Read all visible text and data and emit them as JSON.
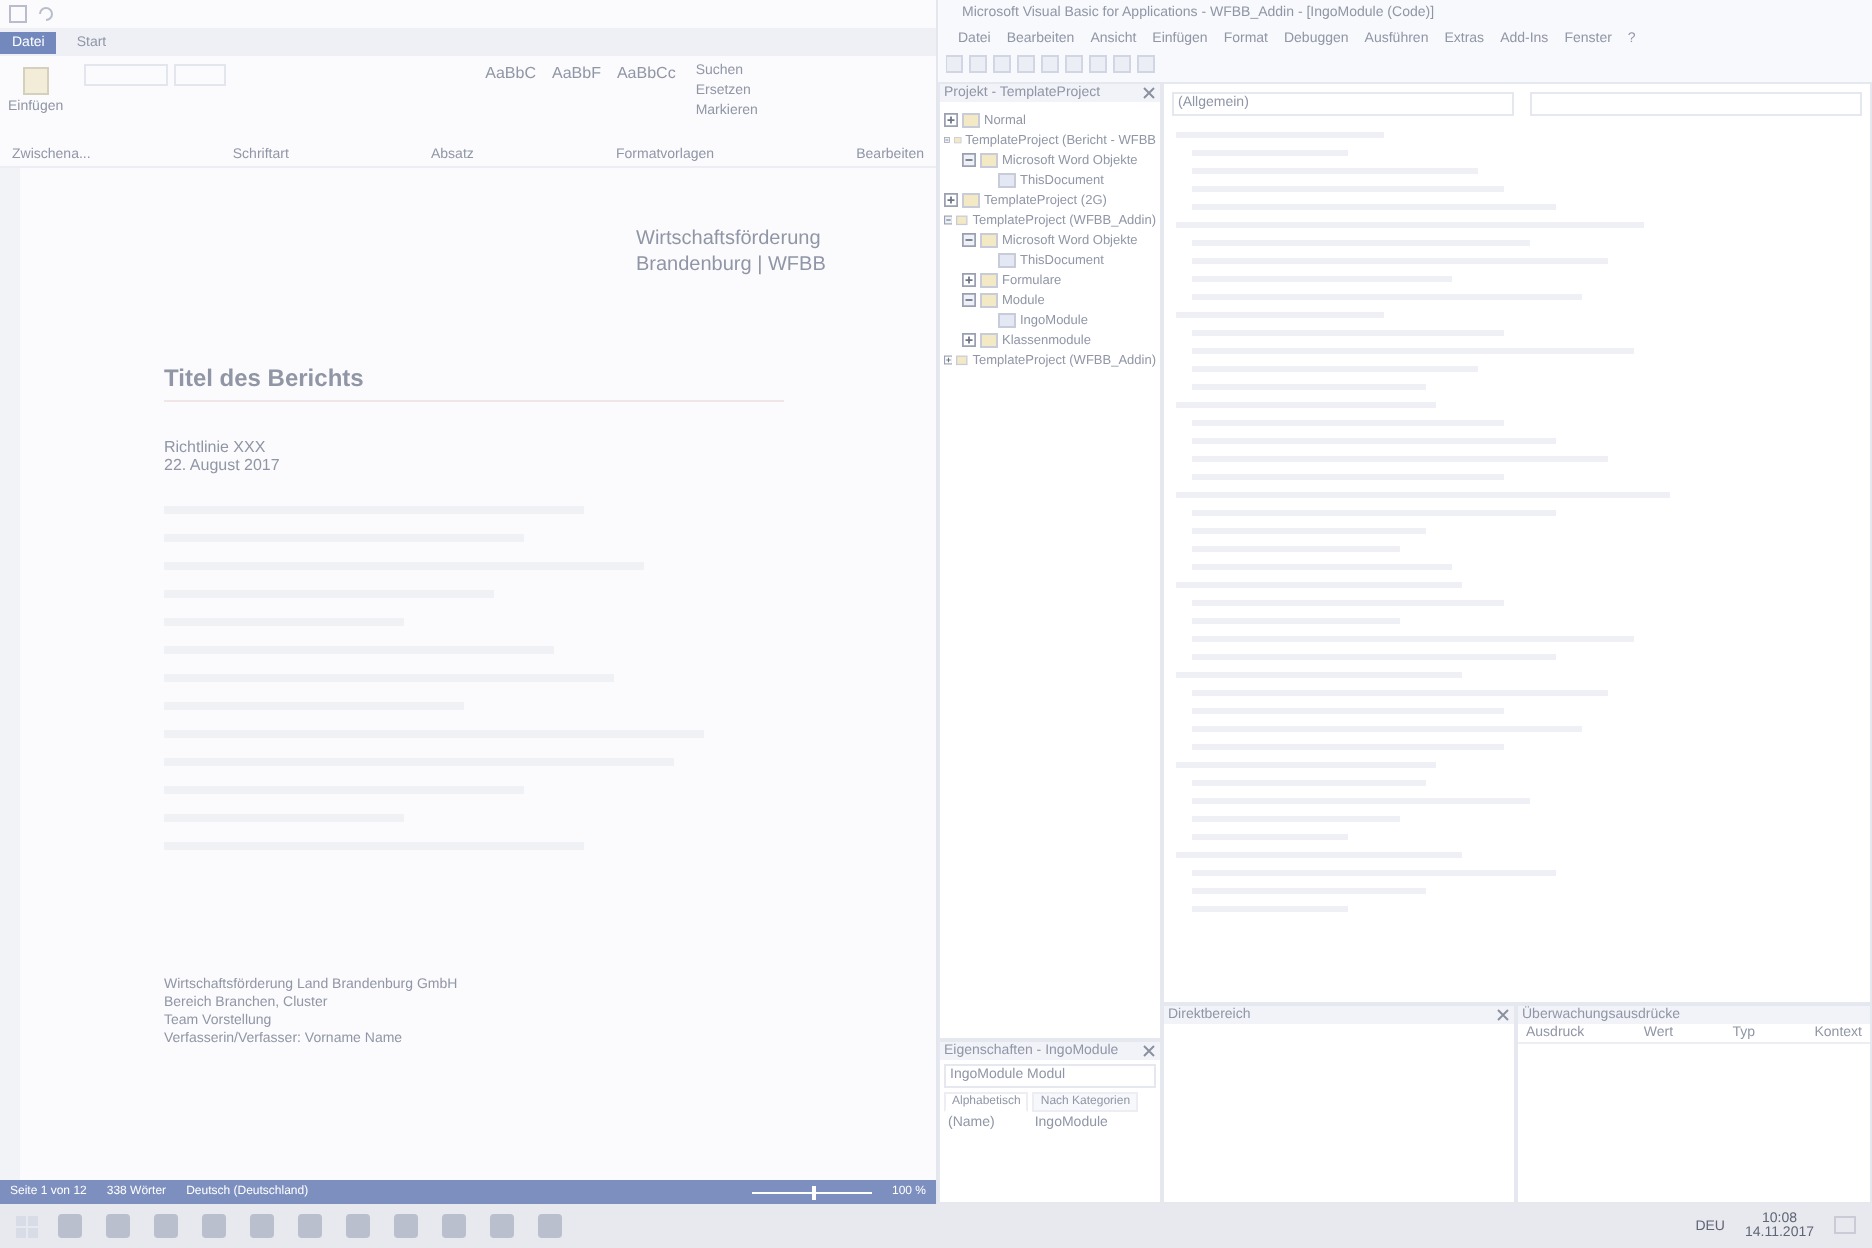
{
  "word": {
    "tabs": [
      {
        "label": "Datei",
        "selected": true
      },
      {
        "label": "Start",
        "selected": false
      }
    ],
    "paste_label": "Einfügen",
    "styles": [
      "AaBbC",
      "AaBbF",
      "AaBbCc"
    ],
    "edit_actions": [
      "Suchen",
      "Ersetzen",
      "Markieren"
    ],
    "groups": [
      "Zwischena...",
      "Schriftart",
      "Absatz",
      "Formatvorlagen",
      "Bearbeiten"
    ],
    "document": {
      "org_lines": [
        "Wirtschaftsförderung",
        "Brandenburg | WFBB"
      ],
      "title": "Titel des Berichts",
      "meta": [
        "Richtlinie XXX",
        "22. August 2017"
      ],
      "footer": [
        "Wirtschaftsförderung Land Brandenburg GmbH",
        "Bereich Branchen, Cluster",
        "Team Vorstellung",
        "Verfasserin/Verfasser: Vorname Name"
      ]
    },
    "status_bar": {
      "page": "Seite 1 von 12",
      "words": "338 Wörter",
      "language": "Deutsch (Deutschland)",
      "zoom": "100 %",
      "zoom_slider": {
        "level": 0.5
      }
    }
  },
  "vba": {
    "title": "Microsoft Visual Basic for Applications - WFBB_Addin - [IngoModule (Code)]",
    "menu": [
      "Datei",
      "Bearbeiten",
      "Ansicht",
      "Einfügen",
      "Format",
      "Debuggen",
      "Ausführen",
      "Extras",
      "Add-Ins",
      "Fenster",
      "?"
    ],
    "project": {
      "title": "Projekt - TemplateProject",
      "tree": [
        {
          "label": "Normal",
          "expanded": false
        },
        {
          "label": "TemplateProject (Bericht - WFBB",
          "expanded": true,
          "children": [
            {
              "label": "Microsoft Word Objekte",
              "expanded": true,
              "children": [
                {
                  "label": "ThisDocument"
                }
              ]
            }
          ]
        },
        {
          "label": "TemplateProject (2G)",
          "expanded": false
        },
        {
          "label": "TemplateProject (WFBB_Addin)",
          "expanded": true,
          "children": [
            {
              "label": "Microsoft Word Objekte",
              "expanded": true,
              "children": [
                {
                  "label": "ThisDocument"
                }
              ]
            },
            {
              "label": "Formulare",
              "expanded": false
            },
            {
              "label": "Module",
              "expanded": true,
              "children": [
                {
                  "label": "IngoModule"
                }
              ]
            },
            {
              "label": "Klassenmodule",
              "expanded": false
            }
          ]
        },
        {
          "label": "TemplateProject (WFBB_Addin)",
          "expanded": false
        }
      ]
    },
    "properties": {
      "title": "Eigenschaften - IngoModule",
      "object": "IngoModule Modul",
      "tabs": [
        {
          "label": "Alphabetisch",
          "selected": true
        },
        {
          "label": "Nach Kategorien",
          "selected": false
        }
      ],
      "rows": [
        {
          "name": "(Name)",
          "value": "IngoModule"
        }
      ]
    },
    "code": {
      "object": "(Allgemein)"
    },
    "immediate": {
      "title": "Direktbereich"
    },
    "watch": {
      "title": "Überwachungsausdrücke",
      "columns": [
        "Ausdruck",
        "Wert",
        "Typ",
        "Kontext"
      ]
    }
  },
  "taskbar": {
    "language": "DEU",
    "time": "10:08",
    "date": "14.11.2017"
  }
}
